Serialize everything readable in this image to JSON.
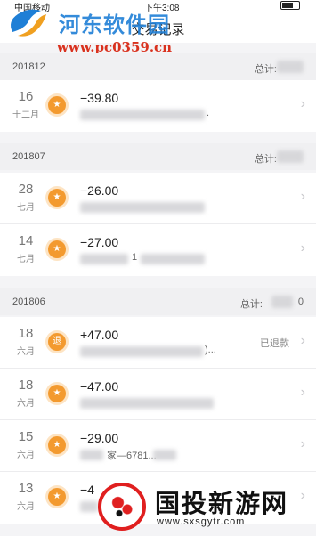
{
  "status_bar": {
    "carrier": "中国移动",
    "time": "下午3:08"
  },
  "nav": {
    "back_icon": "chevron-left",
    "title": "交易记录"
  },
  "watermark_top": {
    "title": "河东软件园",
    "url": "www.pc0359.cn"
  },
  "sections": [
    {
      "month": "201812",
      "total_label": "总计:",
      "rows": [
        {
          "day": "16",
          "month": "十二月",
          "badge": "★",
          "amount": "−39.80",
          "desc_tail": ".",
          "status": ""
        }
      ]
    },
    {
      "month": "201807",
      "total_label": "总计:",
      "rows": [
        {
          "day": "28",
          "month": "七月",
          "badge": "★",
          "amount": "−26.00",
          "desc_tail": "",
          "status": ""
        },
        {
          "day": "14",
          "month": "七月",
          "badge": "★",
          "amount": "−27.00",
          "desc_tail": "1",
          "status": ""
        }
      ]
    },
    {
      "month": "201806",
      "total_label": "总计:",
      "total_tail": "0",
      "rows": [
        {
          "day": "18",
          "month": "六月",
          "badge": "退",
          "amount": "+47.00",
          "desc_tail": ")...",
          "status": "已退款"
        },
        {
          "day": "18",
          "month": "六月",
          "badge": "★",
          "amount": "−47.00",
          "desc_tail": "",
          "status": ""
        },
        {
          "day": "15",
          "month": "六月",
          "badge": "★",
          "amount": "−29.00",
          "desc_tail": "家—6781...",
          "status": ""
        },
        {
          "day": "13",
          "month": "六月",
          "badge": "★",
          "amount": "−4",
          "desc_tail": "",
          "status": ""
        }
      ]
    }
  ],
  "watermark_bottom": {
    "brand": "国投新游网",
    "site": "www.sxsgytr.com"
  },
  "colors": {
    "accent": "#f39a2f",
    "logo_blue": "#1f7fd6",
    "logo_red": "#d9321f"
  }
}
